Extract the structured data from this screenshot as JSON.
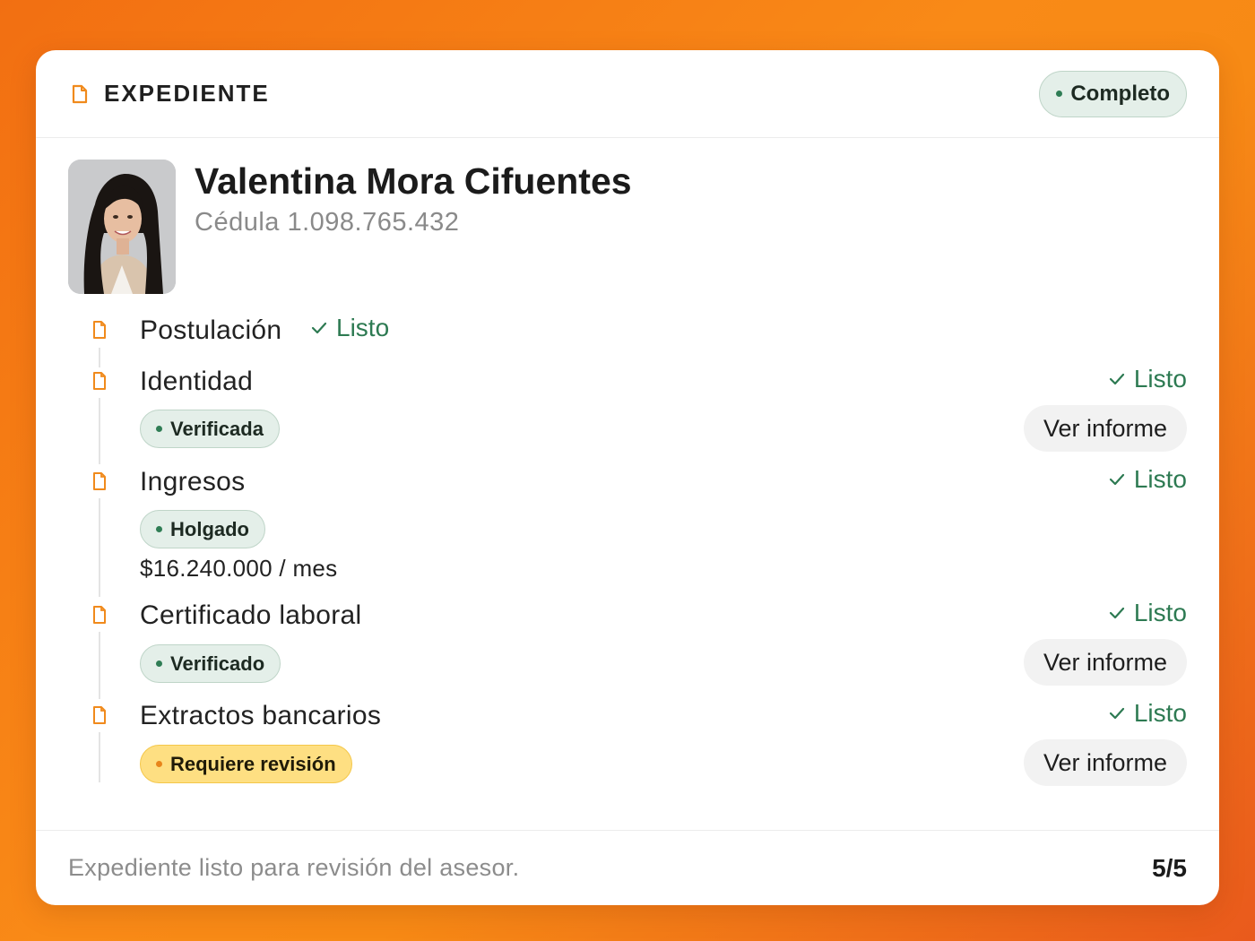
{
  "header": {
    "title": "EXPEDIENTE",
    "status_badge": "Completo",
    "icon": "document-icon"
  },
  "profile": {
    "name": "Valentina Mora Cifuentes",
    "id_text": "Cédula 1.098.765.432"
  },
  "items": [
    {
      "title": "Postulación",
      "status": "Listo"
    },
    {
      "title": "Identidad",
      "status": "Listo",
      "badge": "Verificada",
      "action": "Ver informe"
    },
    {
      "title": "Ingresos",
      "status": "Listo",
      "badge": "Holgado",
      "amount": "$16.240.000 / mes"
    },
    {
      "title": "Certificado laboral",
      "status": "Listo",
      "badge": "Verificado",
      "action": "Ver informe"
    },
    {
      "title": "Extractos bancarios",
      "status": "Listo",
      "badge": "Requiere revisión",
      "action": "Ver informe"
    }
  ],
  "footer": {
    "text": "Expediente listo para revisión del asesor.",
    "count": "5/5"
  },
  "colors": {
    "accent": "#f08a1c",
    "success": "#2d7a52",
    "badge_bg": "#e4efe9",
    "warn_bg": "#fedf82"
  }
}
